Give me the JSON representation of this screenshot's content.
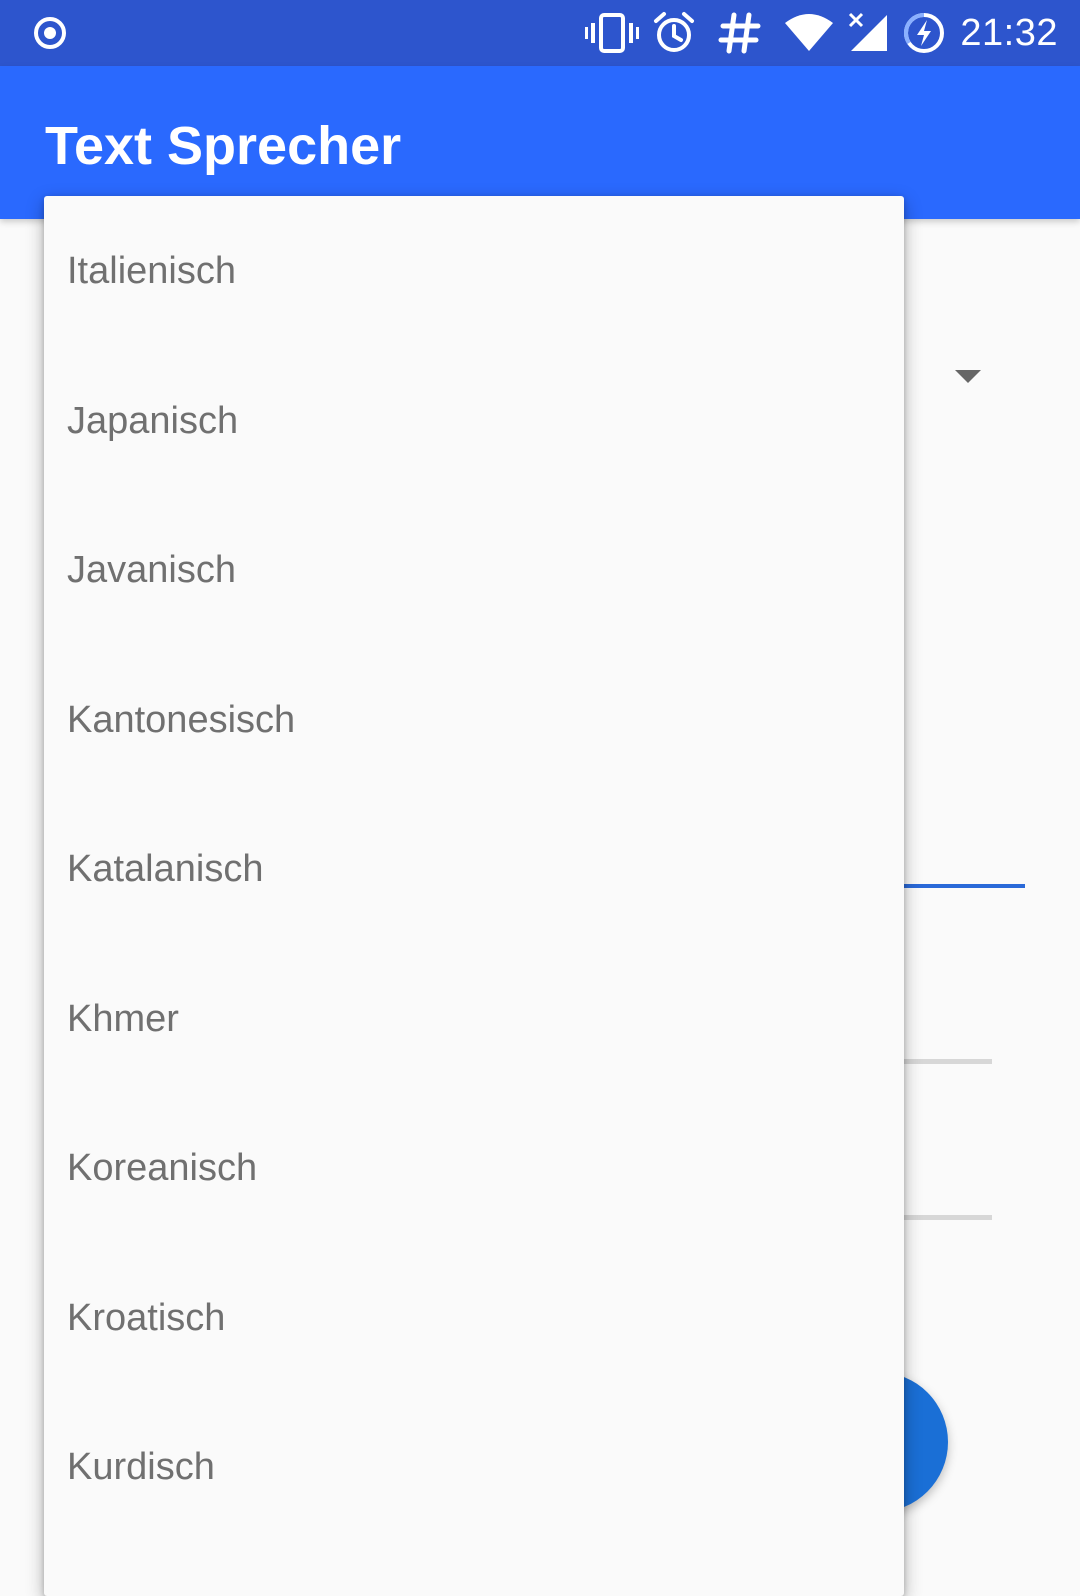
{
  "status_bar": {
    "time": "21:32",
    "icons": [
      "record-icon",
      "vibrate-icon",
      "alarm-icon",
      "hashtag-icon",
      "wifi-icon",
      "signal-no-service-icon",
      "battery-charging-icon"
    ]
  },
  "app_bar": {
    "title": "Text Sprecher"
  },
  "colors": {
    "status_bar": "#2d55cd",
    "app_bar": "#2a69fe",
    "accent": "#1a6fd6",
    "item_text": "#707070"
  },
  "dropdown": {
    "items": [
      {
        "label": "Italienisch"
      },
      {
        "label": "Japanisch"
      },
      {
        "label": "Javanisch"
      },
      {
        "label": "Kantonesisch"
      },
      {
        "label": "Katalanisch"
      },
      {
        "label": "Khmer"
      },
      {
        "label": "Koreanisch"
      },
      {
        "label": "Kroatisch"
      },
      {
        "label": "Kurdisch"
      }
    ]
  }
}
